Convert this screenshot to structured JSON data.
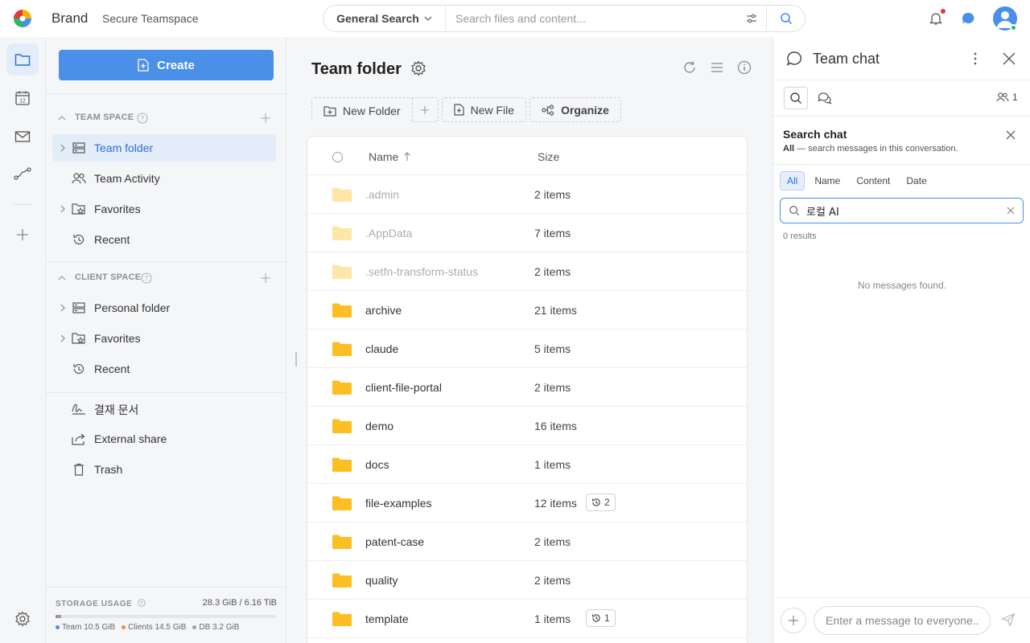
{
  "header": {
    "brand": "Brand",
    "brand_sub": "Secure Teamspace",
    "search_scope": "General Search",
    "search_placeholder": "Search files and content...",
    "icons": [
      "bell-icon",
      "chat-bubble-icon",
      "avatar-icon"
    ]
  },
  "rail": {
    "items": [
      "folder-icon",
      "calendar-icon",
      "mail-icon",
      "workflow-icon",
      "plus-icon",
      "settings-icon"
    ],
    "calendar_day": "12"
  },
  "sidebar": {
    "create_label": "Create",
    "team_space": {
      "label": "TEAM SPACE",
      "items": [
        {
          "label": "Team folder",
          "icon": "server-icon"
        },
        {
          "label": "Team Activity",
          "icon": "people-icon"
        },
        {
          "label": "Favorites",
          "icon": "star-folder-icon"
        },
        {
          "label": "Recent",
          "icon": "history-icon"
        }
      ]
    },
    "client_space": {
      "label": "CLIENT SPACE",
      "items": [
        {
          "label": "Personal folder",
          "icon": "server-icon"
        },
        {
          "label": "Favorites",
          "icon": "star-folder-icon"
        },
        {
          "label": "Recent",
          "icon": "history-icon"
        }
      ]
    },
    "other_items": [
      {
        "label": "결재 문서",
        "icon": "signature-icon"
      },
      {
        "label": "External share",
        "icon": "share-icon"
      },
      {
        "label": "Trash",
        "icon": "trash-icon"
      }
    ],
    "storage": {
      "title": "STORAGE USAGE",
      "value": "28.3 GiB / 6.16 TiB",
      "team": "Team 10.5 GiB",
      "clients": "Clients 14.5 GiB",
      "db": "DB 3.2 GiB",
      "team_color": "#4a8fe8",
      "clients_color": "#f08a3c",
      "db_color": "#9aa0a8",
      "used_fraction": {
        "team": 0.0017,
        "clients": 0.0023,
        "db": 0.0005
      }
    }
  },
  "main": {
    "title": "Team folder",
    "actions": {
      "new_folder": "New Folder",
      "new_file": "New File",
      "organize": "Organize"
    },
    "columns": {
      "name": "Name",
      "size": "Size"
    },
    "rows": [
      {
        "name": ".admin",
        "size": "2 items",
        "hidden": true,
        "versions": ""
      },
      {
        "name": ".AppData",
        "size": "7 items",
        "hidden": true,
        "versions": ""
      },
      {
        "name": ".setfn-transform-status",
        "size": "2 items",
        "hidden": true,
        "versions": ""
      },
      {
        "name": "archive",
        "size": "21 items",
        "hidden": false,
        "versions": ""
      },
      {
        "name": "claude",
        "size": "5 items",
        "hidden": false,
        "versions": ""
      },
      {
        "name": "client-file-portal",
        "size": "2 items",
        "hidden": false,
        "versions": ""
      },
      {
        "name": "demo",
        "size": "16 items",
        "hidden": false,
        "versions": ""
      },
      {
        "name": "docs",
        "size": "1 items",
        "hidden": false,
        "versions": ""
      },
      {
        "name": "file-examples",
        "size": "12 items",
        "hidden": false,
        "versions": "2"
      },
      {
        "name": "patent-case",
        "size": "2 items",
        "hidden": false,
        "versions": ""
      },
      {
        "name": "quality",
        "size": "2 items",
        "hidden": false,
        "versions": ""
      },
      {
        "name": "template",
        "size": "1 items",
        "hidden": false,
        "versions": "1"
      }
    ],
    "folder_color": "#fbbf24",
    "folder_hidden_color": "#fde6a8"
  },
  "chat": {
    "title": "Team chat",
    "member_count": "1",
    "search_title": "Search chat",
    "search_desc_strong": "All",
    "search_desc": " — search messages in this conversation.",
    "filters": [
      "All",
      "Name",
      "Content",
      "Date"
    ],
    "search_value": "로컬 AI",
    "results": "0 results",
    "empty": "No messages found.",
    "input_placeholder": "Enter a message to everyone..."
  }
}
